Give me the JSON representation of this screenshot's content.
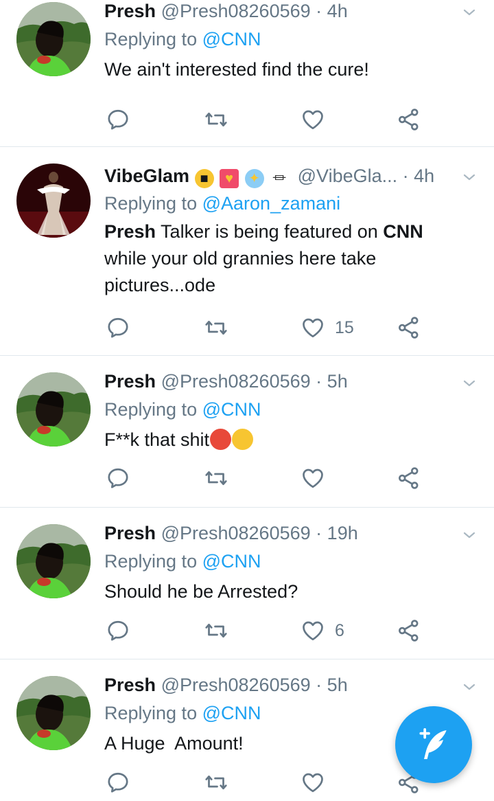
{
  "colors": {
    "accent": "#1da1f2",
    "text_primary": "#14171a",
    "text_secondary": "#657786",
    "divider": "#e1e8ed"
  },
  "replying_prefix": "Replying to",
  "tweets": [
    {
      "name": "Presh",
      "handle": "@Presh08260569",
      "separator": "·",
      "time": "4h",
      "reply_to": "@CNN",
      "text": "We ain't interested find the cure!",
      "reply_count": "",
      "retweet_count": "",
      "like_count": ""
    },
    {
      "name": "VibeGlam",
      "name_emojis": [
        "sunglasses-emoji",
        "heart-gift-emoji",
        "sparkle-emoji",
        "plug-emoji"
      ],
      "handle": "@VibeGla...",
      "separator": "·",
      "time": "4h",
      "reply_to": "@Aaron_zamani",
      "text_bold_1": "Presh",
      "text_mid": " Talker is being featured on ",
      "text_bold_2": "CNN",
      "text_rest": " while your old grannies here take pictures...ode",
      "reply_count": "",
      "retweet_count": "",
      "like_count": "15"
    },
    {
      "name": "Presh",
      "handle": "@Presh08260569",
      "separator": "·",
      "time": "5h",
      "reply_to": "@CNN",
      "text": "F**k that shit",
      "text_emojis": [
        "angry-face-emoji",
        "crying-face-emoji"
      ],
      "reply_count": "",
      "retweet_count": "",
      "like_count": ""
    },
    {
      "name": "Presh",
      "handle": "@Presh08260569",
      "separator": "·",
      "time": "19h",
      "reply_to": "@CNN",
      "text": "Should he be Arrested?",
      "reply_count": "",
      "retweet_count": "",
      "like_count": "6"
    },
    {
      "name": "Presh",
      "handle": "@Presh08260569",
      "separator": "·",
      "time": "5h",
      "reply_to": "@CNN",
      "text": "A Huge  Amount!",
      "reply_count": "",
      "retweet_count": "",
      "like_count": ""
    }
  ],
  "fab": {
    "icon": "compose-feather-icon"
  }
}
